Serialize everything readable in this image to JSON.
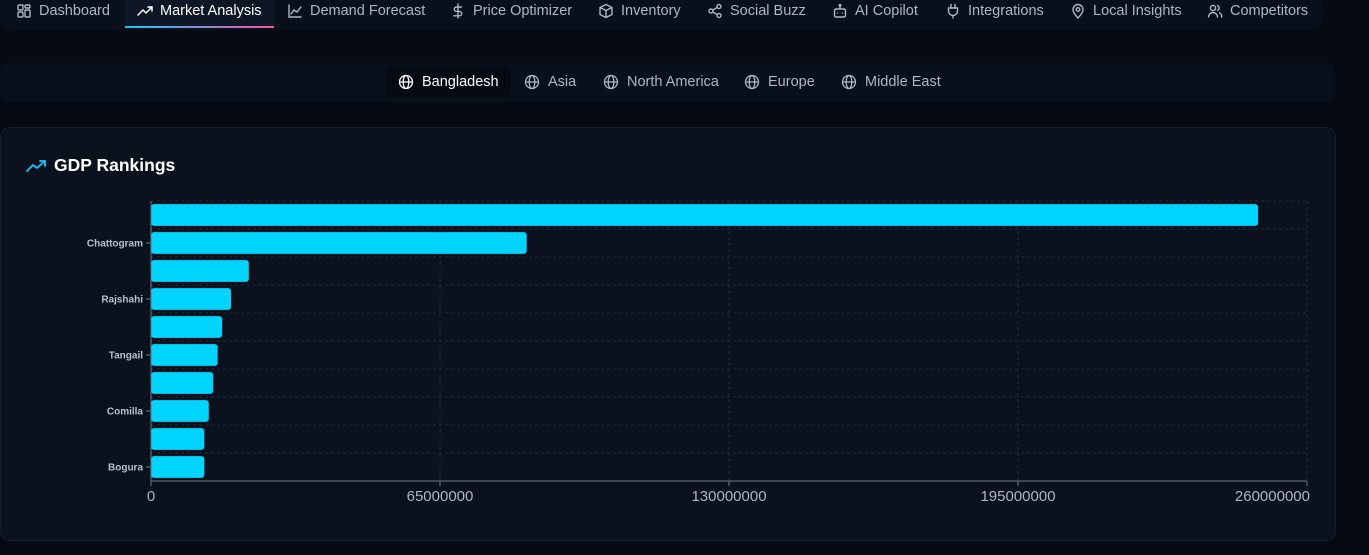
{
  "nav": {
    "tabs": [
      {
        "label": "Dashboard",
        "icon": "dashboard-icon"
      },
      {
        "label": "Market Analysis",
        "icon": "trending-up-icon",
        "active": true
      },
      {
        "label": "Demand Forecast",
        "icon": "line-chart-icon"
      },
      {
        "label": "Price Optimizer",
        "icon": "dollar-icon"
      },
      {
        "label": "Inventory",
        "icon": "box-icon"
      },
      {
        "label": "Social Buzz",
        "icon": "share-icon"
      },
      {
        "label": "AI Copilot",
        "icon": "bot-icon"
      },
      {
        "label": "Integrations",
        "icon": "plug-icon"
      },
      {
        "label": "Local Insights",
        "icon": "map-pin-icon"
      },
      {
        "label": "Competitors",
        "icon": "users-icon"
      }
    ]
  },
  "regions": {
    "items": [
      {
        "label": "Bangladesh",
        "active": true
      },
      {
        "label": "Asia"
      },
      {
        "label": "North America"
      },
      {
        "label": "Europe"
      },
      {
        "label": "Middle East"
      }
    ]
  },
  "card": {
    "title": "GDP Rankings"
  },
  "colors": {
    "bar": "#00d4ff",
    "accent": "#12c9ff",
    "grid": "#1f2a3b"
  },
  "chart_data": {
    "type": "bar",
    "orientation": "horizontal",
    "title": "GDP Rankings",
    "categories": [
      "",
      "Chattogram",
      "",
      "Rajshahi",
      "",
      "Tangail",
      "",
      "Comilla",
      "",
      "Bogura"
    ],
    "values": [
      249000000,
      84500000,
      22000000,
      18000000,
      16000000,
      15000000,
      14000000,
      13000000,
      12000000,
      12000000
    ],
    "xlim": [
      0,
      260000000
    ],
    "xticks": [
      "0",
      "65000000",
      "130000000",
      "195000000",
      "260000000"
    ],
    "grid": true
  }
}
